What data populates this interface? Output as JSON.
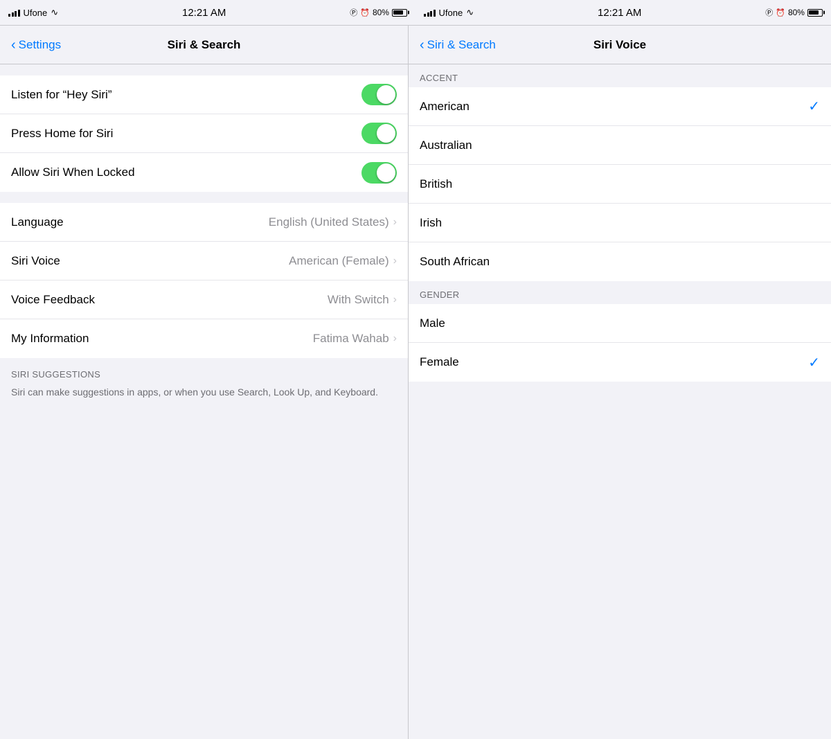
{
  "statusBar": {
    "left": {
      "carrier": "Ufone",
      "time": "12:21 AM",
      "battery": "80%"
    },
    "right": {
      "carrier": "Ufone",
      "time": "12:21 AM",
      "battery": "80%"
    }
  },
  "leftPanel": {
    "navBack": "Settings",
    "navTitle": "Siri & Search",
    "rows": [
      {
        "label": "Listen for “Hey Siri”",
        "type": "toggle",
        "value": true
      },
      {
        "label": "Press Home for Siri",
        "type": "toggle",
        "value": true
      },
      {
        "label": "Allow Siri When Locked",
        "type": "toggle",
        "value": true
      },
      {
        "label": "Language",
        "type": "nav",
        "value": "English (United States)"
      },
      {
        "label": "Siri Voice",
        "type": "nav",
        "value": "American (Female)"
      },
      {
        "label": "Voice Feedback",
        "type": "nav",
        "value": "With Switch"
      },
      {
        "label": "My Information",
        "type": "nav",
        "value": "Fatima Wahab"
      }
    ],
    "suggestionsTitle": "SIRI SUGGESTIONS",
    "suggestionsText": "Siri can make suggestions in apps, or when you use Search, Look Up, and Keyboard."
  },
  "rightPanel": {
    "navBack": "Siri & Search",
    "navTitle": "Siri Voice",
    "accentHeader": "ACCENT",
    "accents": [
      {
        "label": "American",
        "selected": true
      },
      {
        "label": "Australian",
        "selected": false
      },
      {
        "label": "British",
        "selected": false
      },
      {
        "label": "Irish",
        "selected": false
      },
      {
        "label": "South African",
        "selected": false
      }
    ],
    "genderHeader": "GENDER",
    "genders": [
      {
        "label": "Male",
        "selected": false
      },
      {
        "label": "Female",
        "selected": true
      }
    ]
  }
}
